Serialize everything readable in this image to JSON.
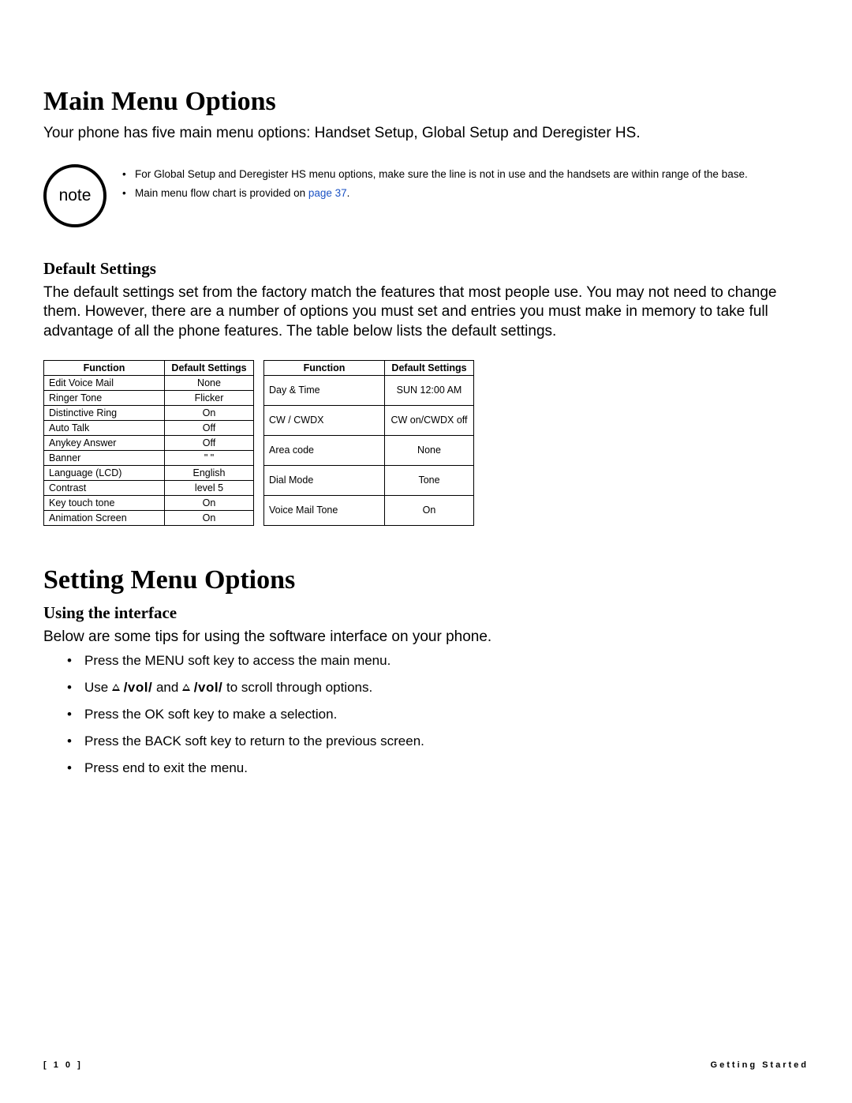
{
  "heading1": "Main Menu Options",
  "intro": "Your phone has five main menu options: Handset Setup, Global Setup and Deregister HS.",
  "note_label": "note",
  "notes": [
    "For Global Setup and Deregister HS menu options, make sure the line is not in use and the handsets are within range of the base.",
    "Main menu flow chart is provided on "
  ],
  "notes_link": "page 37",
  "notes_after": ".",
  "sub_default": "Default Settings",
  "default_body": "The default settings set from the factory match the features that most people use. You may not need to change them. However, there are a number of options you must set and entries you must make in memory to take full advantage of all the phone features. The table below lists the default settings.",
  "headers": {
    "fn": "Function",
    "ds": "Default Settings"
  },
  "table1": [
    {
      "fn": "Edit Voice Mail",
      "ds": "None"
    },
    {
      "fn": "Ringer Tone",
      "ds": "Flicker"
    },
    {
      "fn": "Distinctive Ring",
      "ds": "On"
    },
    {
      "fn": "Auto Talk",
      "ds": "Off"
    },
    {
      "fn": "Anykey Answer",
      "ds": "Off"
    },
    {
      "fn": "Banner",
      "ds": "\"   \""
    },
    {
      "fn": "Language (LCD)",
      "ds": "English"
    },
    {
      "fn": "Contrast",
      "ds": "level 5"
    },
    {
      "fn": "Key touch tone",
      "ds": "On"
    },
    {
      "fn": "Animation Screen",
      "ds": "On"
    }
  ],
  "table2": [
    {
      "fn": "Day & Time",
      "ds": "SUN 12:00 AM"
    },
    {
      "fn": "CW / CWDX",
      "ds": "CW on/CWDX off"
    },
    {
      "fn": "Area code",
      "ds": "None"
    },
    {
      "fn": "Dial Mode",
      "ds": "Tone"
    },
    {
      "fn": "Voice Mail Tone",
      "ds": "On"
    }
  ],
  "heading2": "Setting Menu Options",
  "sub_interface": "Using the interface",
  "interface_body": "Below are some tips for using the software interface on your phone.",
  "tips": {
    "menu": "Press the MENU soft key to access the main menu.",
    "use_prefix": "Use ",
    "vol": "/vol/",
    "and": " and ",
    "use_suffix": " to scroll through options.",
    "ok": "Press the OK soft key to make a selection.",
    "back": "Press the BACK soft key to return to the previous screen.",
    "press": "Press ",
    "end": "end",
    "exit": " to exit the menu."
  },
  "footer": {
    "page": "[  1 0  ]",
    "section": "Getting Started"
  }
}
